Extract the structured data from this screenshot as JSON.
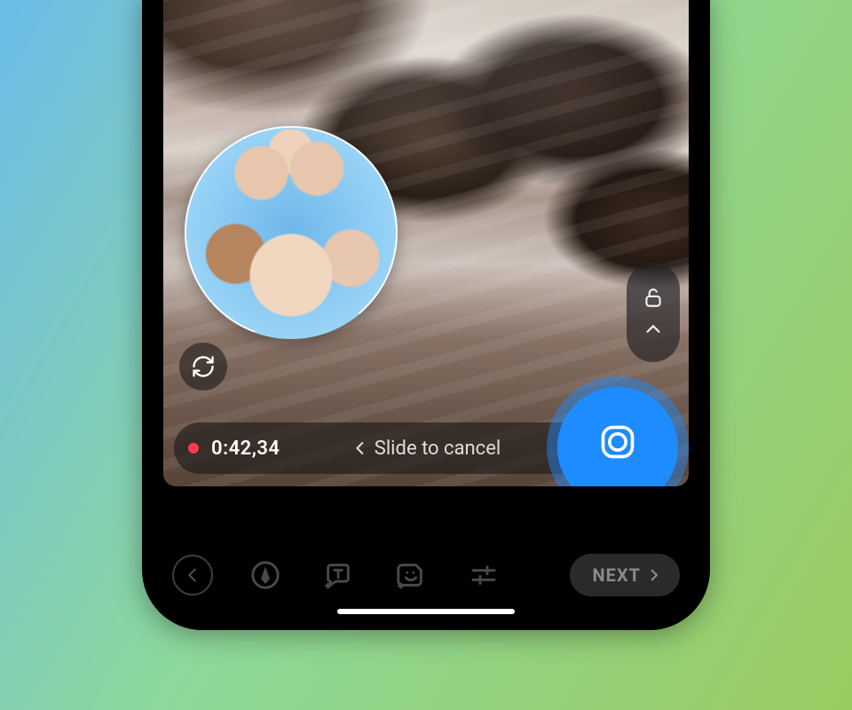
{
  "recording": {
    "timer": "0:42,34",
    "slide_hint": "Slide to cancel"
  },
  "next_button": {
    "label": "NEXT"
  },
  "icons": {
    "sync": "sync-icon",
    "lock": "lock-open-icon",
    "chevron_up": "chevron-up-icon",
    "chevron_left": "chevron-left-icon",
    "shutter": "camera-shutter-icon",
    "back": "chevron-left-icon",
    "pen": "pen-icon",
    "text_add": "text-add-icon",
    "sticker_add": "sticker-add-icon",
    "sliders": "sliders-icon",
    "next_chevron": "chevron-right-icon"
  }
}
